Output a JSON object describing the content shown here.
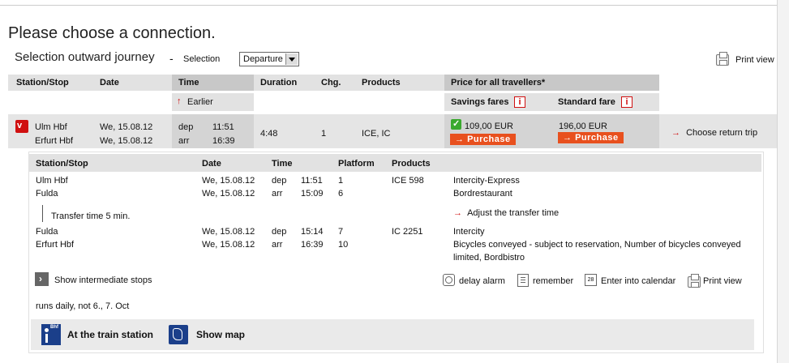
{
  "page": {
    "heading": "Please choose a connection.",
    "subheading": "Selection outward journey",
    "dash": "-",
    "selection_label": "Selection",
    "selection_value": "Departure",
    "print_view": "Print view"
  },
  "results_header": {
    "station": "Station/Stop",
    "date": "Date",
    "time": "Time",
    "duration": "Duration",
    "changes": "Chg.",
    "products": "Products",
    "price": "Price for all travellers*",
    "earlier": "Earlier",
    "savings_fares": "Savings fares",
    "standard_fare": "Standard fare",
    "info_glyph": "i"
  },
  "connection": {
    "from": "Ulm Hbf",
    "to": "Erfurt Hbf",
    "date_dep": "We, 15.08.12",
    "date_arr": "We, 15.08.12",
    "dep_label": "dep",
    "arr_label": "arr",
    "dep_time": "11:51",
    "arr_time": "16:39",
    "duration": "4:48",
    "changes": "1",
    "products": "ICE, IC",
    "savings_price": "109,00 EUR",
    "standard_price": "196,00 EUR",
    "purchase_label": "Purchase",
    "choose_return": "Choose return trip"
  },
  "details": {
    "header": {
      "station": "Station/Stop",
      "date": "Date",
      "time": "Time",
      "platform": "Platform",
      "products": "Products"
    },
    "legs": [
      {
        "from": "Ulm Hbf",
        "to": "Fulda",
        "date_dep": "We, 15.08.12",
        "date_arr": "We, 15.08.12",
        "dep_label": "dep",
        "arr_label": "arr",
        "dep_time": "11:51",
        "arr_time": "15:09",
        "dep_platform": "1",
        "arr_platform": "6",
        "train": "ICE 598",
        "info1": "Intercity-Express",
        "info2": "Bordrestaurant",
        "info3": ""
      },
      {
        "from": "Fulda",
        "to": "Erfurt Hbf",
        "date_dep": "We, 15.08.12",
        "date_arr": "We, 15.08.12",
        "dep_label": "dep",
        "arr_label": "arr",
        "dep_time": "15:14",
        "arr_time": "16:39",
        "dep_platform": "7",
        "arr_platform": "10",
        "train": "IC 2251",
        "info1": "Intercity",
        "info2": "Bicycles conveyed - subject to reservation, Number of bicycles conveyed",
        "info3": "limited, Bordbistro"
      }
    ],
    "transfer_time": "Transfer time 5 min.",
    "adjust_transfer": "Adjust the transfer time",
    "show_stops": "Show intermediate stops",
    "delay_alarm": "delay alarm",
    "remember": "remember",
    "calendar": "Enter into calendar",
    "print_view": "Print view",
    "runs": "runs daily, not 6., 7. Oct",
    "at_station": "At the train station",
    "show_map": "Show map",
    "bhf_icon_text": "Bhf",
    "calendar_icon_text": "28"
  },
  "colors": {
    "accent_red": "#d01010",
    "purchase_orange": "#e8501e",
    "header_grey": "#e2e2e2",
    "dark_grey": "#c8c8c8",
    "check_green": "#3aa92e",
    "station_blue": "#1b3f8a"
  }
}
